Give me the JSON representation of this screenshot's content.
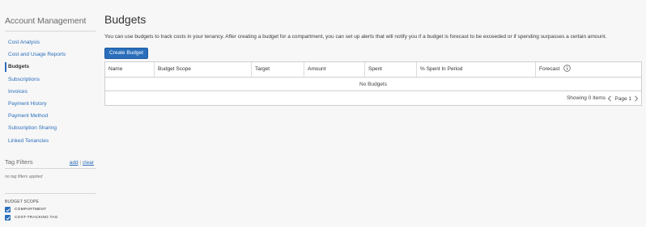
{
  "sidebar": {
    "title": "Account Management",
    "items": [
      {
        "label": "Cost Analysis",
        "active": false
      },
      {
        "label": "Cost and Usage Reports",
        "active": false
      },
      {
        "label": "Budgets",
        "active": true
      },
      {
        "label": "Subscriptions",
        "active": false
      },
      {
        "label": "Invoices",
        "active": false
      },
      {
        "label": "Payment History",
        "active": false
      },
      {
        "label": "Payment Method",
        "active": false
      },
      {
        "label": "Subscription Sharing",
        "active": false
      },
      {
        "label": "Linked Tenancies",
        "active": false
      }
    ]
  },
  "tag_filters": {
    "title": "Tag Filters",
    "add_label": "add",
    "separator": "|",
    "clear_label": "clear",
    "empty_text": "no tag filters applied",
    "budget_scope_label": "BUDGET SCOPE",
    "options": [
      {
        "label": "COMPARTMENT",
        "checked": true
      },
      {
        "label": "COST-TRACKING TAG",
        "checked": true
      }
    ]
  },
  "main": {
    "title": "Budgets",
    "description": "You can use budgets to track costs in your tenancy. After creating a budget for a compartment, you can set up alerts that will notify you if a budget is forecast to be exceeded or if spending surpasses a certain amount.",
    "create_button": "Create Budget"
  },
  "table": {
    "columns": [
      "Name",
      "Budget Scope",
      "Target",
      "Amount",
      "Spent",
      "% Spent In Period",
      "Forecast"
    ],
    "empty_text": "No Budgets",
    "showing_text": "Showing 0 Items",
    "page_label": "Page 1"
  },
  "colors": {
    "accent": "#2a6ebb",
    "background": "#f7f7f7",
    "border": "#cfcfcf"
  }
}
